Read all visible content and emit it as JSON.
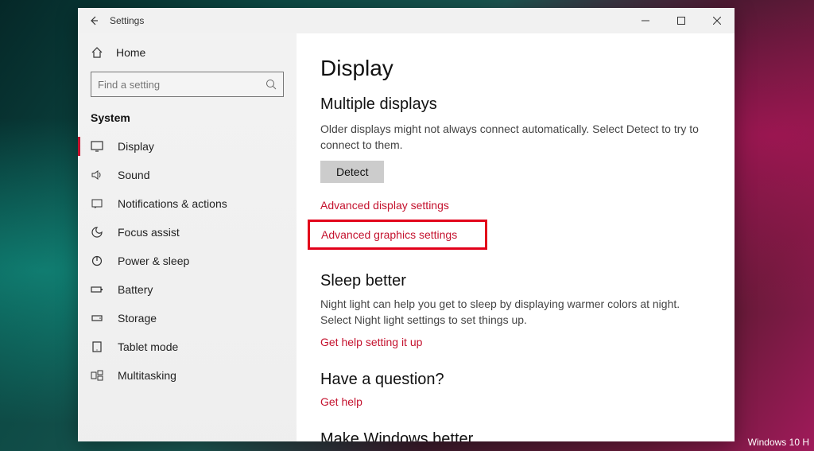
{
  "window": {
    "title": "Settings"
  },
  "sidebar": {
    "home": "Home",
    "search_placeholder": "Find a setting",
    "category": "System",
    "items": [
      {
        "label": "Display"
      },
      {
        "label": "Sound"
      },
      {
        "label": "Notifications & actions"
      },
      {
        "label": "Focus assist"
      },
      {
        "label": "Power & sleep"
      },
      {
        "label": "Battery"
      },
      {
        "label": "Storage"
      },
      {
        "label": "Tablet mode"
      },
      {
        "label": "Multitasking"
      }
    ]
  },
  "content": {
    "page_title": "Display",
    "multiple_displays": {
      "title": "Multiple displays",
      "body": "Older displays might not always connect automatically. Select Detect to try to connect to them.",
      "detect": "Detect",
      "link1": "Advanced display settings",
      "link2": "Advanced graphics settings"
    },
    "sleep_better": {
      "title": "Sleep better",
      "body": "Night light can help you get to sleep by displaying warmer colors at night. Select Night light settings to set things up.",
      "link": "Get help setting it up"
    },
    "question": {
      "title": "Have a question?",
      "link": "Get help"
    },
    "make_better": {
      "title": "Make Windows better"
    }
  },
  "watermark": "Windows 10 H"
}
